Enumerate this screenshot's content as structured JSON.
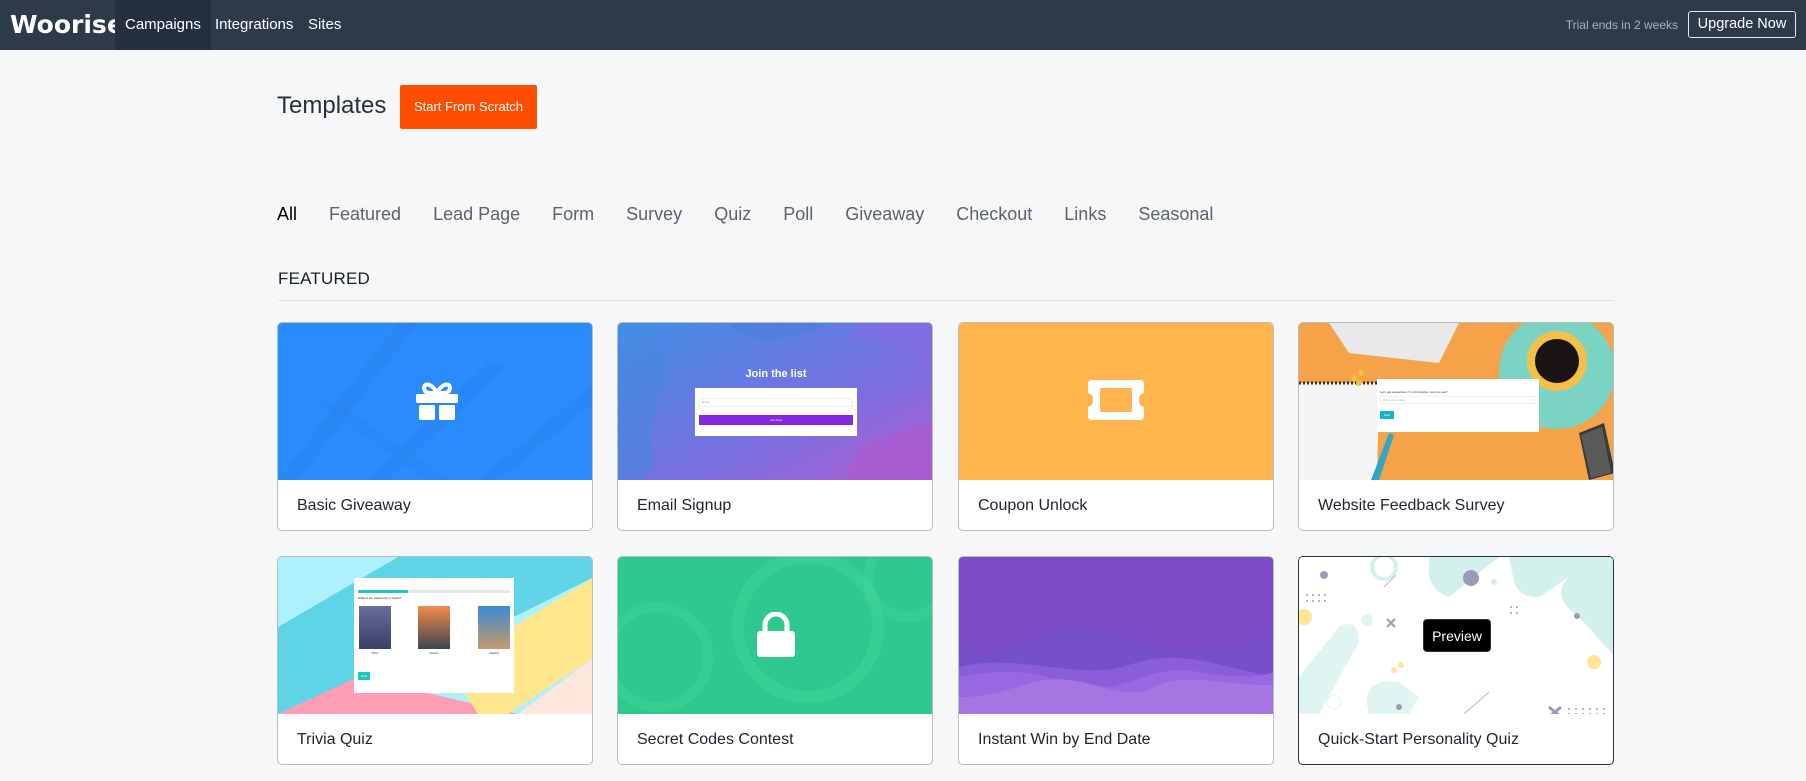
{
  "nav": {
    "logo": "Woorise",
    "items": [
      {
        "label": "Campaigns",
        "active": true
      },
      {
        "label": "Integrations",
        "active": false
      },
      {
        "label": "Sites",
        "active": false
      }
    ],
    "trial_text": "Trial ends in 2 weeks",
    "upgrade_label": "Upgrade Now"
  },
  "header": {
    "title": "Templates",
    "start_button": "Start From Scratch"
  },
  "tabs": [
    {
      "label": "All",
      "active": true
    },
    {
      "label": "Featured",
      "active": false
    },
    {
      "label": "Lead Page",
      "active": false
    },
    {
      "label": "Form",
      "active": false
    },
    {
      "label": "Survey",
      "active": false
    },
    {
      "label": "Quiz",
      "active": false
    },
    {
      "label": "Poll",
      "active": false
    },
    {
      "label": "Giveaway",
      "active": false
    },
    {
      "label": "Checkout",
      "active": false
    },
    {
      "label": "Links",
      "active": false
    },
    {
      "label": "Seasonal",
      "active": false
    }
  ],
  "section": {
    "title": "FEATURED"
  },
  "cards": [
    {
      "title": "Basic Giveaway",
      "icon": "gift-icon",
      "bg": "#2a8bfb"
    },
    {
      "title": "Email Signup",
      "thumb_heading": "Join the list",
      "thumb_field_placeholder": "Email",
      "thumb_button": "Join Now"
    },
    {
      "title": "Coupon Unlock",
      "icon": "ticket-icon",
      "bg": "#ffb44e"
    },
    {
      "title": "Website Feedback Survey",
      "thumb_question": "Let's get acquainted. I'm Christopher. And you are?",
      "thumb_field_placeholder": "Enter your name",
      "thumb_button": "Next"
    },
    {
      "title": "Trivia Quiz",
      "thumb_question": "What is the capital city of Spain?",
      "thumb_progress": "33%",
      "thumb_options": [
        "Paris",
        "Athens",
        "Madrid"
      ],
      "thumb_button": "Next"
    },
    {
      "title": "Secret Codes Contest",
      "icon": "lock-icon",
      "bg": "#2ec98e"
    },
    {
      "title": "Instant Win by End Date",
      "bg": "#7b4cc5"
    },
    {
      "title": "Quick-Start Personality Quiz",
      "preview_label": "Preview"
    }
  ],
  "colors": {
    "nav_bg": "#2d3a4a",
    "accent": "#ff4d00",
    "page_bg": "#f6f7f9"
  }
}
